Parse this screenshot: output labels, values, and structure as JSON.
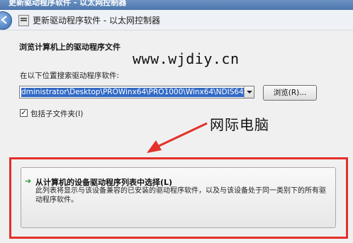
{
  "window": {
    "title": "更新驱动程序软件 - 以太网控制器"
  },
  "nav": {
    "title": "更新驱动程序软件 - 以太网控制器",
    "back_icon": "back-arrow-icon"
  },
  "content": {
    "heading": "浏览计算机上的驱动程序文件",
    "watermark": "www.wjdiy.cn",
    "search_label": "在以下位置搜索驱动程序软件:",
    "path_value": "dministrator\\Desktop\\PROWinx64\\PRO1000\\Winx64\\NDIS64",
    "browse_label": "浏览(R)...",
    "include_subfolders_label": "包括子文件夹(I)",
    "include_subfolders_checked": true,
    "annotation": "网际电脑",
    "option": {
      "title": "从计算机的设备驱动程序列表中选择(L)",
      "description": "此列表将显示与该设备兼容的已安装的驱动程序软件，以及与该设备处于同一类别下的所有驱动程序软件。"
    }
  },
  "colors": {
    "highlight": "#e3312b",
    "selection": "#3169c6",
    "option_arrow": "#2e9c2e"
  }
}
